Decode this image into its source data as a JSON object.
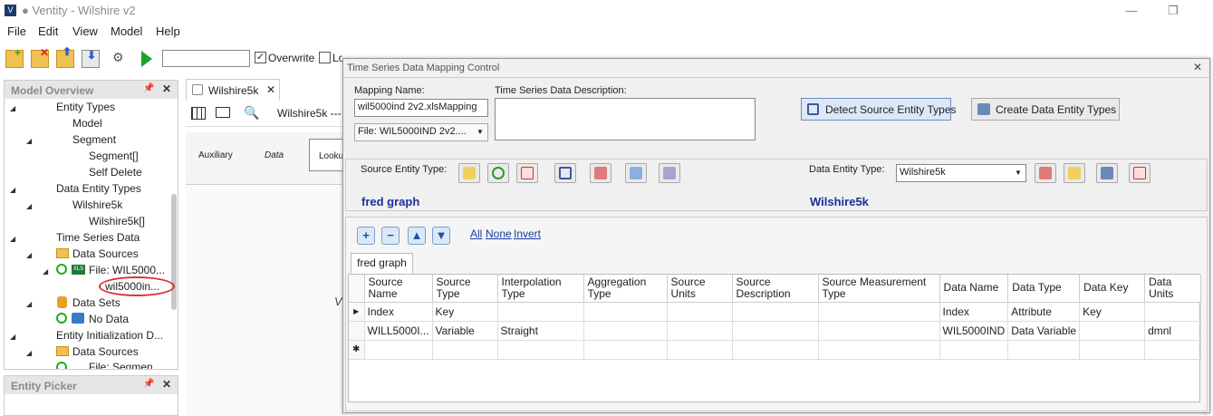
{
  "window": {
    "title": "● Ventity - Wilshire v2",
    "app_icon": "V"
  },
  "menu": [
    "File",
    "Edit",
    "View",
    "Model",
    "Help"
  ],
  "toolbar": {
    "overwrite_label": "Overwrite",
    "overwrite_checked": "✓",
    "log_label": "Log Actions",
    "search_value": ""
  },
  "model_overview": {
    "title": "Model Overview",
    "items": [
      "Entity Types",
      "Model",
      "Segment",
      "Segment[]",
      "Self Delete",
      "Data Entity Types",
      "Wilshire5k",
      "Wilshire5k[]",
      "Time Series Data",
      "Data Sources",
      "File: WIL5000...",
      "wil5000in...",
      "Data Sets",
      "No Data",
      "Entity Initialization D...",
      "Data Sources",
      "File: Segmen..."
    ]
  },
  "entity_picker": {
    "title": "Entity Picker"
  },
  "middle": {
    "tab_label": "Wilshire5k",
    "breadcrumb": "Wilshire5k ---",
    "ribbon": [
      "Auxiliary",
      "Data",
      "Lookup"
    ],
    "canvas_letter": "V"
  },
  "dialog": {
    "title": "Time Series Data Mapping Control",
    "mapping_name_label": "Mapping Name:",
    "mapping_name_value": "wil5000ind 2v2.xlsMapping",
    "file_value": "File: WIL5000IND 2v2....",
    "desc_label": "Time Series Data Description:",
    "detect_button": "Detect Source Entity Types",
    "create_button": "Create Data Entity Types",
    "source_entity_label": "Source Entity Type:",
    "source_entity_value": "fred graph",
    "data_entity_label": "Data Entity Type:",
    "data_entity_select": "Wilshire5k",
    "data_entity_value": "Wilshire5k",
    "links": {
      "all": "All",
      "none": "None",
      "invert": "Invert"
    },
    "grid_tab": "fred graph",
    "columns": [
      "Source Name",
      "Source Type",
      "Interpolation Type",
      "Aggregation Type",
      "Source Units",
      "Source Description",
      "Source Measurement Type",
      "Data Name",
      "Data Type",
      "Data Key",
      "Data Units"
    ],
    "rows": [
      [
        "Index",
        "Key",
        "",
        "",
        "",
        "",
        "",
        "Index",
        "Attribute",
        "Key",
        ""
      ],
      [
        "WILL5000I...",
        "Variable",
        "Straight",
        "",
        "",
        "",
        "",
        "WIL5000IND",
        "Data Variable",
        "",
        "dmnl"
      ]
    ]
  }
}
